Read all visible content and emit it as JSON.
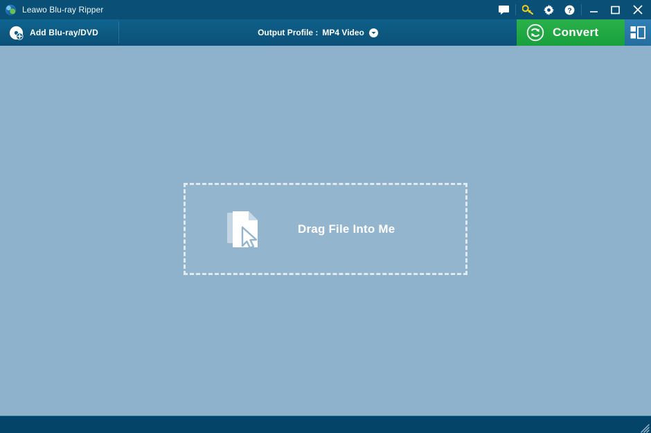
{
  "window": {
    "title": "Leawo Blu-ray Ripper",
    "app_icon": "globe-icon",
    "controls": {
      "feedback": "feedback-icon",
      "key": "key-icon",
      "settings": "gear-icon",
      "help": "help-icon",
      "minimize": "minimize-icon",
      "maximize": "maximize-icon",
      "close": "close-icon"
    }
  },
  "toolbar": {
    "add_label": "Add Blu-ray/DVD",
    "add_icon": "disc-plus-icon",
    "profile_label": "Output Profile :",
    "profile_value": "MP4 Video",
    "profile_caret_icon": "chevron-down-circle-icon",
    "convert_label": "Convert",
    "convert_icon": "convert-refresh-icon",
    "panel_toggle_icon": "panel-layout-icon"
  },
  "stage": {
    "dropzone_text": "Drag File Into Me",
    "dropzone_icon": "file-cursor-icon"
  },
  "statusbar": {
    "text": "",
    "resize_grip_icon": "resize-grip-icon"
  },
  "colors": {
    "titlebar": "#0a5076",
    "toolbar": "#0d5d86",
    "stage_background": "#8fb2cc",
    "convert_green": "#22aa44",
    "panel_toggle_blue": "#2f7fb5",
    "statusbar": "#034468",
    "key_icon_yellow": "#f2cf1b",
    "text_white": "#ffffff"
  }
}
